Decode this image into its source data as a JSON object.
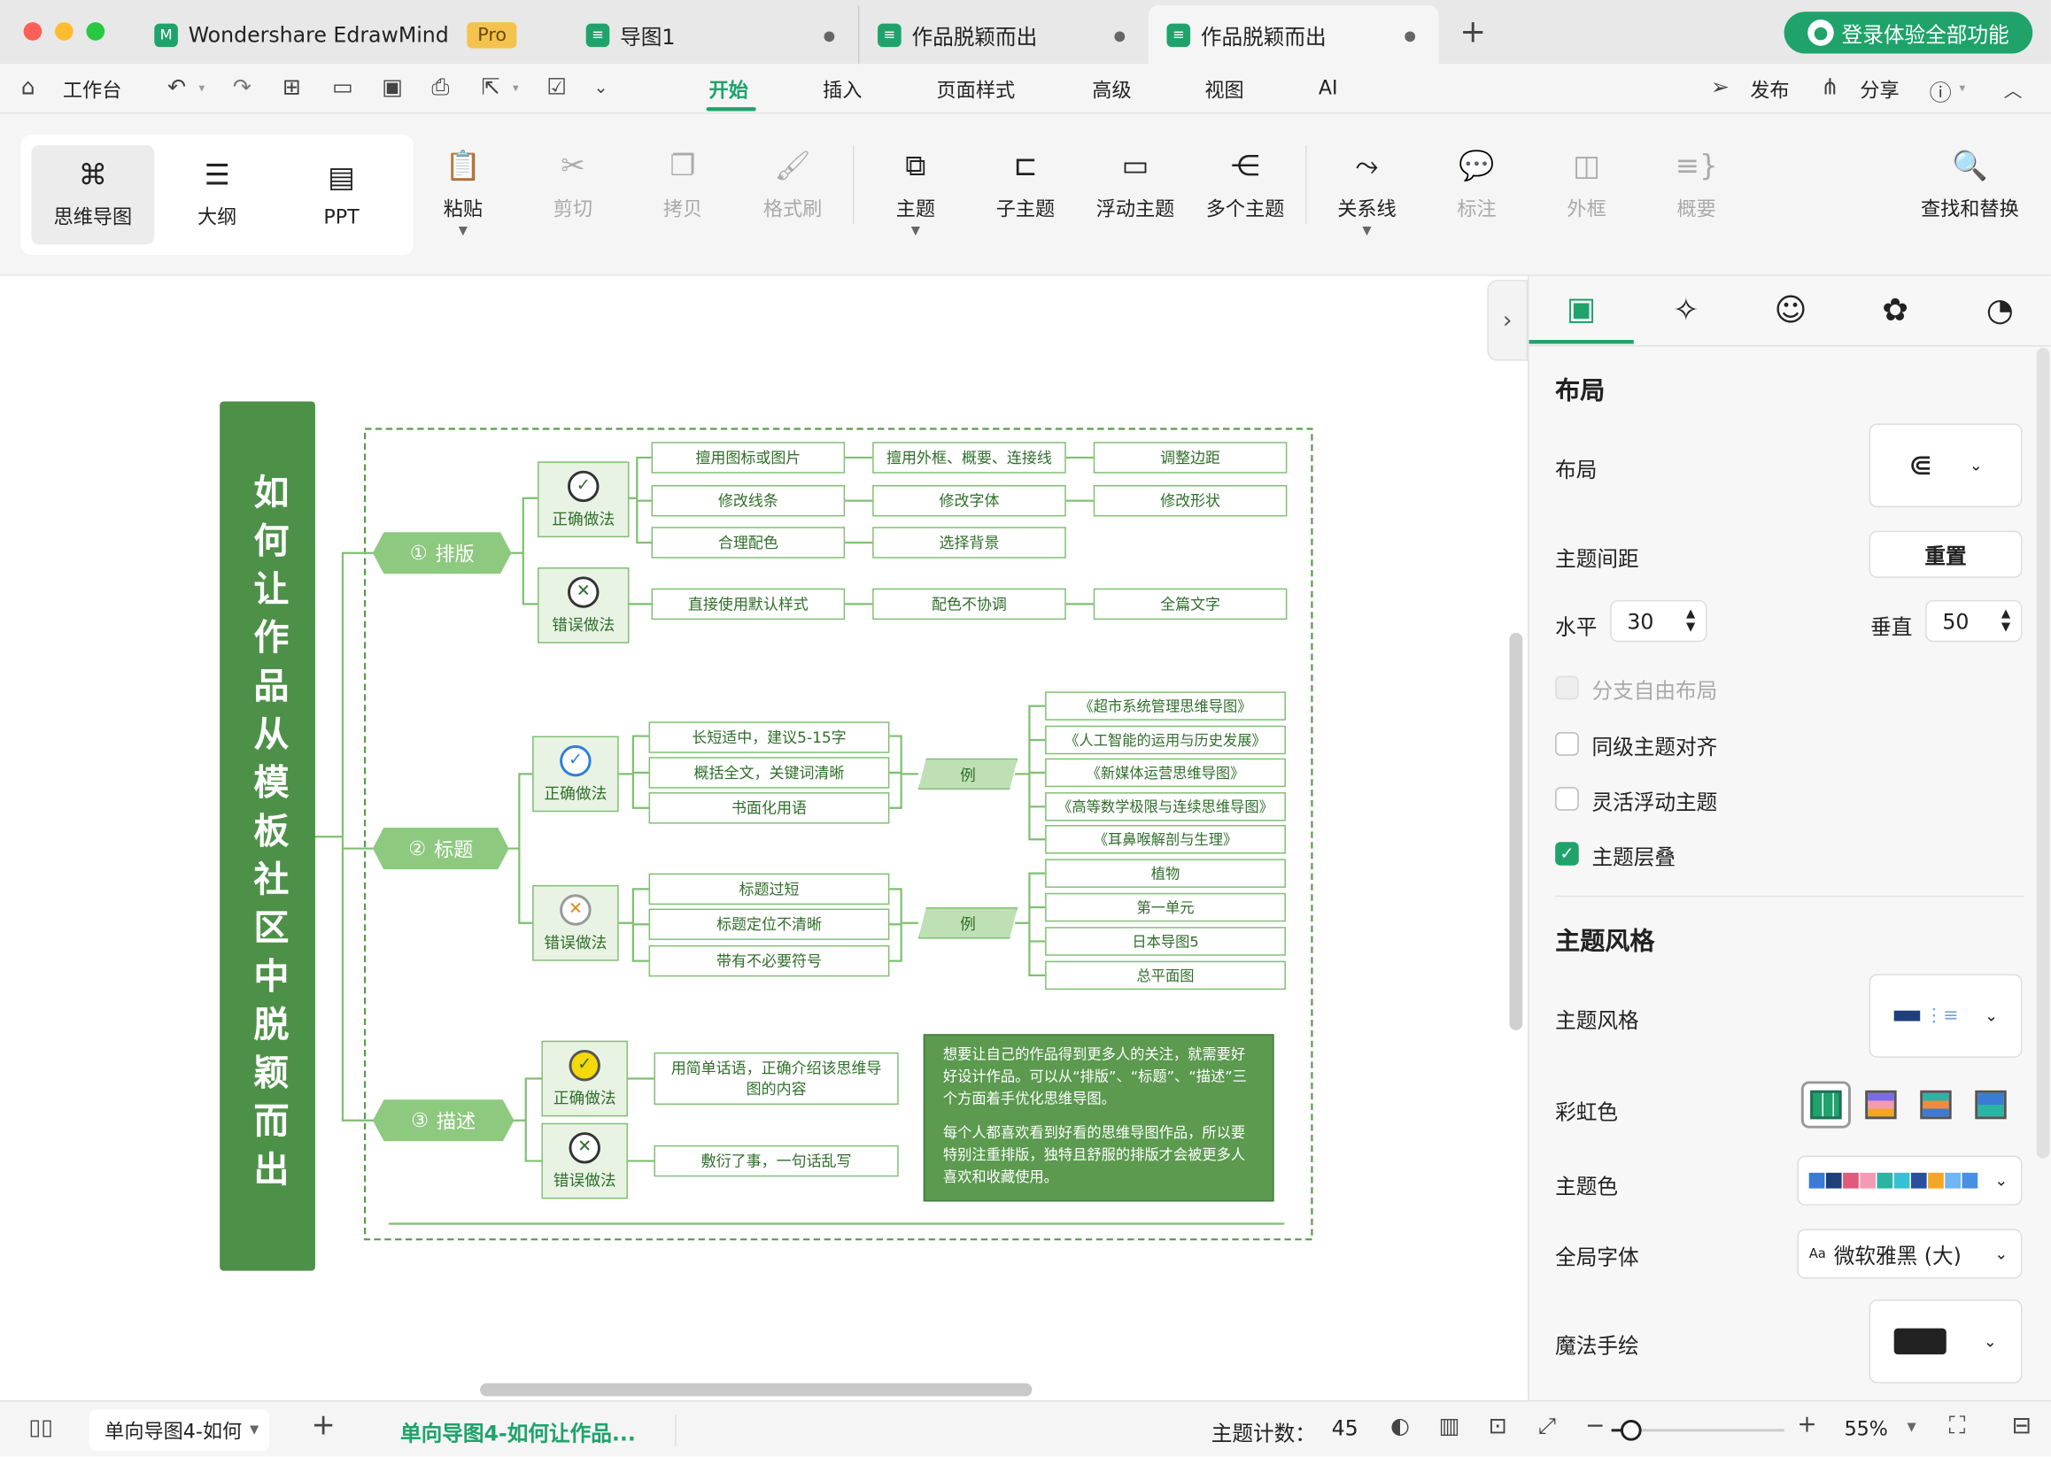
{
  "window": {
    "tabs": [
      {
        "label": "Wondershare EdrawMind",
        "badge": "Pro"
      },
      {
        "label": "导图1"
      },
      {
        "label": "作品脱颖而出"
      },
      {
        "label": "作品脱颖而出"
      }
    ],
    "login_label": "登录体验全部功能"
  },
  "menubar": {
    "workbench": "工作台",
    "tabs": [
      "开始",
      "插入",
      "页面样式",
      "高级",
      "视图",
      "AI"
    ],
    "active_tab": "开始",
    "publish": "发布",
    "share": "分享"
  },
  "ribbon": {
    "views": [
      "思维导图",
      "大纲",
      "PPT"
    ],
    "tools": [
      {
        "label": "粘贴",
        "icon": "clipboard-icon",
        "enabled": true
      },
      {
        "label": "剪切",
        "icon": "scissors-icon",
        "enabled": false
      },
      {
        "label": "拷贝",
        "icon": "copy-icon",
        "enabled": false
      },
      {
        "label": "格式刷",
        "icon": "brush-icon",
        "enabled": false
      },
      {
        "label": "主题",
        "icon": "topic-icon",
        "enabled": true
      },
      {
        "label": "子主题",
        "icon": "subtopic-icon",
        "enabled": true
      },
      {
        "label": "浮动主题",
        "icon": "floating-topic-icon",
        "enabled": true
      },
      {
        "label": "多个主题",
        "icon": "multi-topic-icon",
        "enabled": true
      },
      {
        "label": "关系线",
        "icon": "relation-icon",
        "enabled": true
      },
      {
        "label": "标注",
        "icon": "callout-icon",
        "enabled": false
      },
      {
        "label": "外框",
        "icon": "boundary-icon",
        "enabled": false
      },
      {
        "label": "概要",
        "icon": "summary-icon",
        "enabled": false
      },
      {
        "label": "查找和替换",
        "icon": "find-replace-icon",
        "enabled": true
      }
    ]
  },
  "mindmap": {
    "title": "如何让作品从模板社区中脱颖而出",
    "branches": [
      {
        "num": "①",
        "label": "排版"
      },
      {
        "num": "②",
        "label": "标题"
      },
      {
        "num": "③",
        "label": "描述"
      }
    ],
    "correct": "正确做法",
    "wrong": "错误做法",
    "example": "例",
    "layout_correct": [
      "擅用图标或图片",
      "擅用外框、概要、连接线",
      "调整边距",
      "修改线条",
      "修改字体",
      "修改形状",
      "合理配色",
      "选择背景"
    ],
    "layout_wrong": [
      "直接使用默认样式",
      "配色不协调",
      "全篇文字"
    ],
    "title_correct": [
      "长短适中，建议5-15字",
      "概括全文，关键词清晰",
      "书面化用语"
    ],
    "title_correct_examples": [
      "《超市系统管理思维导图》",
      "《人工智能的运用与历史发展》",
      "《新媒体运营思维导图》",
      "《高等数学极限与连续思维导图》",
      "《耳鼻喉解剖与生理》"
    ],
    "title_wrong": [
      "标题过短",
      "标题定位不清晰",
      "带有不必要符号"
    ],
    "title_wrong_examples": [
      "植物",
      "第一单元",
      "日本导图5",
      "总平面图"
    ],
    "desc_correct": "用简单话语，正确介绍该思维导图的内容",
    "desc_wrong": "敷衍了事，一句话乱写",
    "note_p1": "想要让自己的作品得到更多人的关注，就需要好好设计作品。可以从“排版”、“标题”、“描述”三个方面着手优化思维导图。",
    "note_p2": "每个人都喜欢看到好看的思维导图作品，所以要特别注重排版，独特且舒服的排版才会被更多人喜欢和收藏使用。"
  },
  "panel": {
    "section_layout": "布局",
    "layout_label": "布局",
    "spacing_label": "主题间距",
    "reset_label": "重置",
    "horizontal_label": "水平",
    "horizontal_value": "30",
    "vertical_label": "垂直",
    "vertical_value": "50",
    "free_layout": "分支自由布局",
    "align_same_level": "同级主题对齐",
    "flexible_float": "灵活浮动主题",
    "topic_overlap": "主题层叠",
    "section_style": "主题风格",
    "style_label": "主题风格",
    "rainbow_label": "彩虹色",
    "theme_color_label": "主题色",
    "font_label": "全局字体",
    "font_value": "微软雅黑 (大)",
    "hand_drawn_label": "魔法手绘",
    "theme_colors": [
      "#3a7bd5",
      "#1f3f7a",
      "#e05a7b",
      "#f29bb5",
      "#2bb3a3",
      "#35c0d6",
      "#2a4f9e",
      "#f5a623",
      "#6fb6f5",
      "#4a90e2"
    ]
  },
  "status": {
    "sheet_tab": "单向导图4-如何",
    "sheet_active": "单向导图4-如何让作品...",
    "topic_count_label": "主题计数：",
    "topic_count": "45",
    "zoom": "55%"
  }
}
